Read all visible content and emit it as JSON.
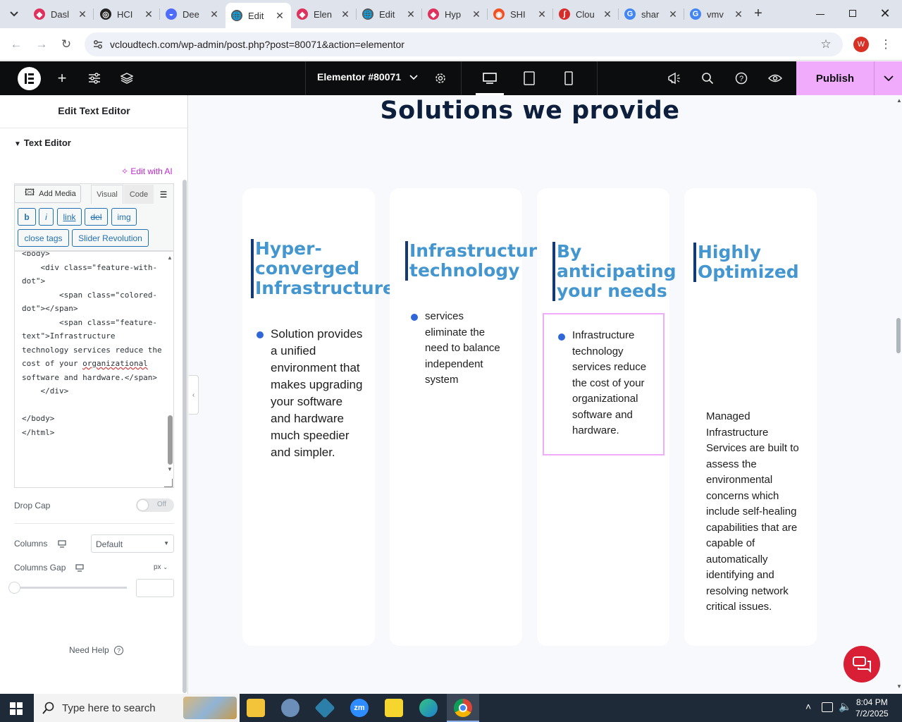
{
  "browser": {
    "tabs": [
      {
        "title": "Dasl",
        "color": "#e0315c",
        "glyph": "◆"
      },
      {
        "title": "HCI",
        "color": "#222222",
        "glyph": "◎"
      },
      {
        "title": "Dee",
        "color": "#4d6bfe",
        "glyph": "◒"
      },
      {
        "title": "Edit",
        "color": "#555555",
        "glyph": "🌐"
      },
      {
        "title": "Elen",
        "color": "#e0315c",
        "glyph": "◆"
      },
      {
        "title": "Edit",
        "color": "#555555",
        "glyph": "🌐"
      },
      {
        "title": "Hyp",
        "color": "#e0315c",
        "glyph": "◆"
      },
      {
        "title": "SHI",
        "color": "#f25022",
        "glyph": "◉"
      },
      {
        "title": "Clou",
        "color": "#d72c2c",
        "glyph": "∫"
      },
      {
        "title": "shar",
        "color": "#4285f4",
        "glyph": "G"
      },
      {
        "title": "vmv",
        "color": "#4285f4",
        "glyph": "G"
      }
    ],
    "active_tab_index": 3,
    "url": "vcloudtech.com/wp-admin/post.php?post=80071&action=elementor",
    "profile_initial": "W"
  },
  "elementor": {
    "doc_title": "Elementor #80071",
    "publish_label": "Publish"
  },
  "panel": {
    "title": "Edit Text Editor",
    "section": "Text Editor",
    "edit_ai": "Edit with AI",
    "add_media": "Add Media",
    "tab_visual": "Visual",
    "tab_code": "Code",
    "quicktags": [
      "b",
      "i",
      "link",
      "del",
      "img",
      "close tags",
      "Slider Revolution"
    ],
    "code_before": "<body>\n    <div class=\"feature-with-dot\">\n        <span class=\"colored-dot\"></span>\n        <span class=\"feature-text\">Infrastructure technology services reduce the cost of your ",
    "code_spell": "organizational",
    "code_after": " software and hardware.</span>\n    </div>\n\n</body>\n</html>",
    "drop_cap_label": "Drop Cap",
    "drop_cap_state": "Off",
    "columns_label": "Columns",
    "columns_value": "Default",
    "columns_gap_label": "Columns Gap",
    "columns_gap_unit": "px",
    "need_help": "Need Help"
  },
  "canvas": {
    "section_title": "Solutions we provide",
    "cards": [
      {
        "heading": [
          "Hyper-",
          "converged",
          "Infrastructure"
        ],
        "text": "Solution provides a unified environment that makes upgrading your software and hardware much speedier and simpler."
      },
      {
        "heading": [
          "Infrastructure",
          "technology"
        ],
        "text": "services eliminate the need to balance independent system"
      },
      {
        "heading": [
          "By",
          "anticipating",
          "your needs"
        ],
        "text": "Infrastructure technology services reduce the cost of your organizational software and hardware."
      },
      {
        "heading": [
          "Highly",
          "Optimized"
        ],
        "text": "Managed Infrastructure Services are built to assess the environmental concerns which include self-healing capabilities that are capable of automatically identifying and resolving network critical issues."
      }
    ]
  },
  "taskbar": {
    "search_placeholder": "Type here to search",
    "time": "8:04 PM",
    "date": "7/2/2025"
  },
  "colors": {
    "accent": "#f0abfc",
    "heading_blue": "#4396cf",
    "dot_blue": "#2f67d8",
    "dark": "#0c0d0e"
  }
}
